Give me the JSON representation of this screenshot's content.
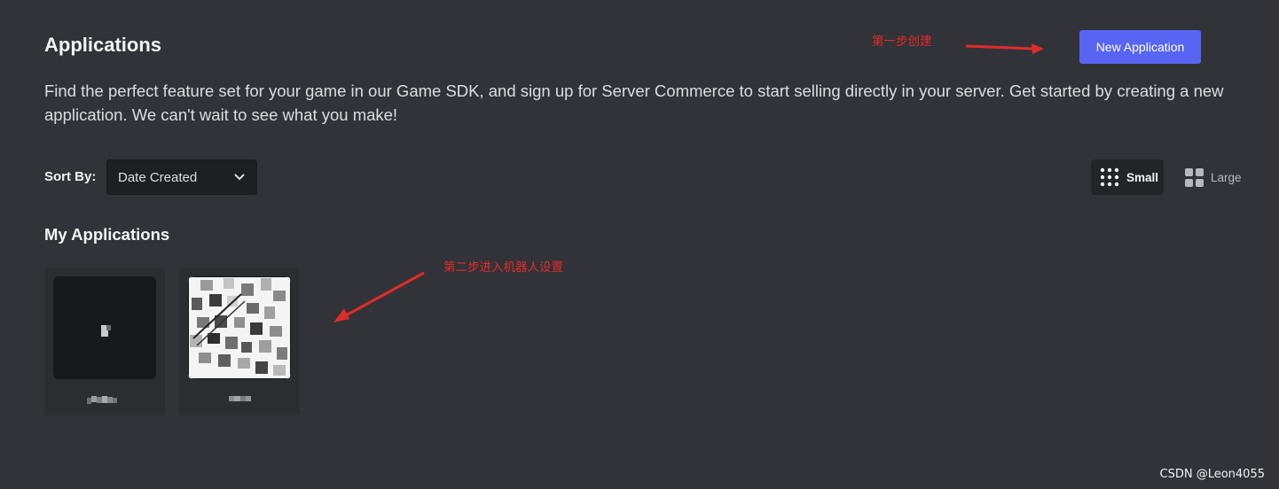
{
  "header": {
    "title": "Applications",
    "description": "Find the perfect feature set for your game in our Game SDK, and sign up for Server Commerce to start selling directly in your server. Get started by creating a new application. We can't wait to see what you make!",
    "new_app_label": "New Application"
  },
  "annotations": {
    "step1": "第一步创建",
    "step2": "第二步进入机器人设置",
    "color": "#e02b2b"
  },
  "sort": {
    "label": "Sort By:",
    "selected": "Date Created",
    "icon": "chevron-down-icon"
  },
  "view_toggle": {
    "small_label": "Small",
    "large_label": "Large",
    "active": "Small",
    "small_icon": "grid-small-icon",
    "large_icon": "grid-large-icon"
  },
  "my_apps": {
    "title": "My Applications",
    "count": 2
  },
  "watermark": "CSDN @Leon4055",
  "colors": {
    "background": "#313338",
    "card": "#2b2d31",
    "accent": "#5865f2",
    "input_bg": "#1e1f22"
  }
}
